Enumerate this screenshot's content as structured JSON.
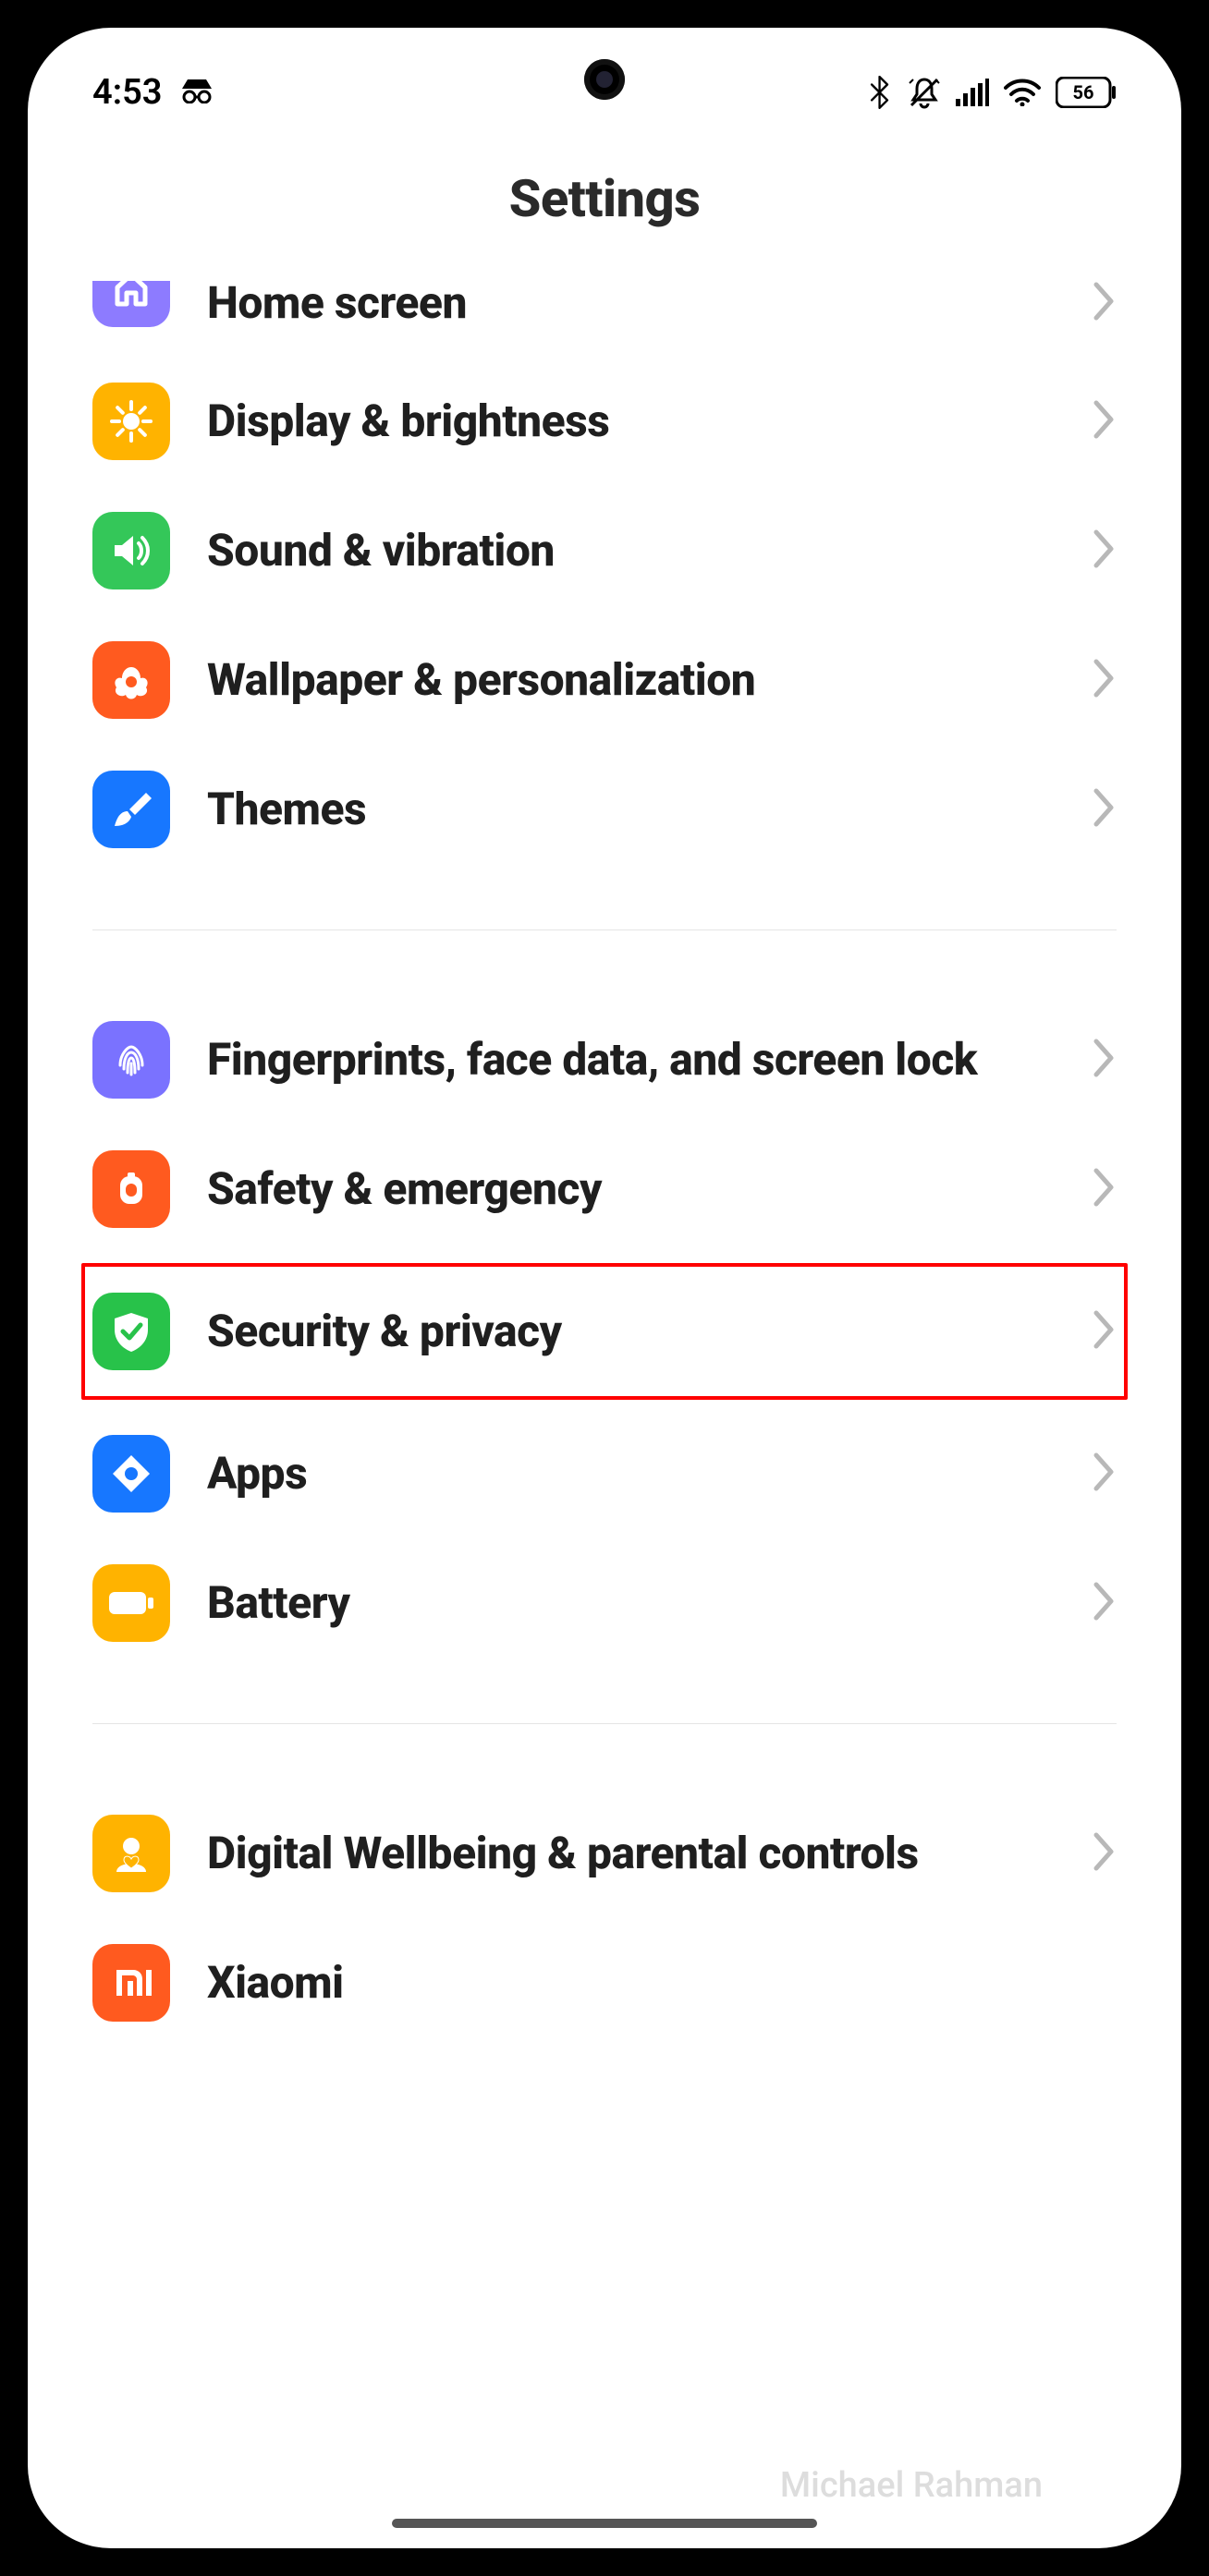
{
  "status_bar": {
    "time": "4:53",
    "battery_pct": "56"
  },
  "header": {
    "title": "Settings"
  },
  "colors": {
    "home_screen": "#8d7bff",
    "display": "#ffb300",
    "sound": "#34c759",
    "wallpaper": "#ff5a1f",
    "themes": "#1777ff",
    "fingerprint": "#7a72ff",
    "safety": "#ff5a1f",
    "security": "#28c24a",
    "apps": "#1777ff",
    "battery": "#ffb300",
    "wellbeing": "#ffb300",
    "xiaomi": "#ff5a1f"
  },
  "groups": [
    {
      "items": [
        {
          "key": "home_screen",
          "label": "Home screen",
          "icon": "home-icon",
          "color_key": "home_screen",
          "cut_top": true
        },
        {
          "key": "display",
          "label": "Display & brightness",
          "icon": "sun-icon",
          "color_key": "display"
        },
        {
          "key": "sound",
          "label": "Sound & vibration",
          "icon": "speaker-icon",
          "color_key": "sound"
        },
        {
          "key": "wallpaper",
          "label": "Wallpaper & personaliza­tion",
          "icon": "flower-icon",
          "color_key": "wallpaper"
        },
        {
          "key": "themes",
          "label": "Themes",
          "icon": "brush-icon",
          "color_key": "themes"
        }
      ]
    },
    {
      "items": [
        {
          "key": "fingerprint",
          "label": "Fingerprints, face data, and screen lock",
          "icon": "fingerprint-icon",
          "color_key": "fingerprint"
        },
        {
          "key": "safety",
          "label": "Safety & emergency",
          "icon": "sos-icon",
          "color_key": "safety"
        },
        {
          "key": "security",
          "label": "Security & privacy",
          "icon": "shield-check-icon",
          "color_key": "security",
          "highlighted": true
        },
        {
          "key": "apps",
          "label": "Apps",
          "icon": "apps-icon",
          "color_key": "apps"
        },
        {
          "key": "battery",
          "label": "Battery",
          "icon": "battery-icon",
          "color_key": "battery"
        }
      ]
    },
    {
      "items": [
        {
          "key": "wellbeing",
          "label": "Digital Wellbeing & parental controls",
          "icon": "person-heart-icon",
          "color_key": "wellbeing"
        },
        {
          "key": "xiaomi",
          "label": "Xiaomi",
          "icon": "mi-icon",
          "color_key": "xiaomi",
          "partial": true
        }
      ]
    }
  ],
  "watermark": "Michael Rahman"
}
